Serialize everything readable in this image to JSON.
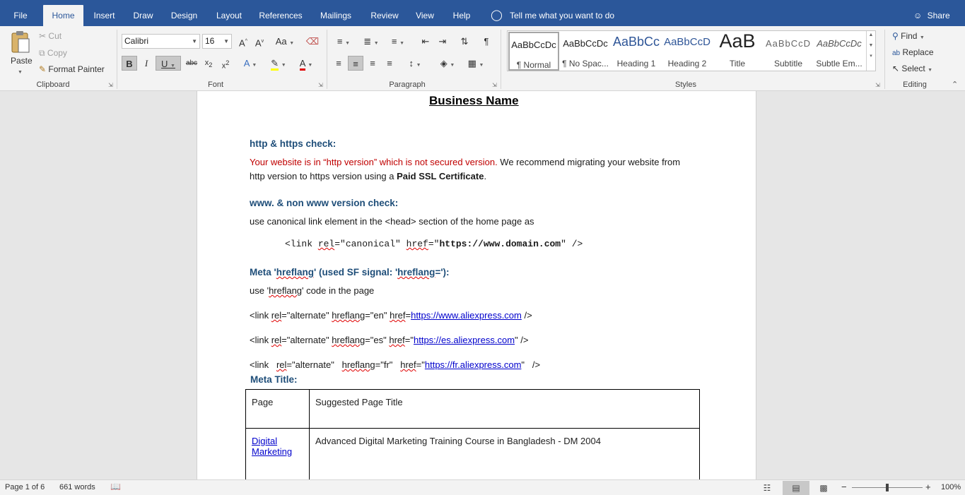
{
  "tabs": {
    "file": "File",
    "home": "Home",
    "insert": "Insert",
    "draw": "Draw",
    "design": "Design",
    "layout": "Layout",
    "references": "References",
    "mailings": "Mailings",
    "review": "Review",
    "view": "View",
    "help": "Help"
  },
  "tell_me": "Tell me what you want to do",
  "share": "Share",
  "clipboard": {
    "paste": "Paste",
    "cut": "Cut",
    "copy": "Copy",
    "format_painter": "Format Painter",
    "label": "Clipboard"
  },
  "font": {
    "name": "Calibri",
    "size": "16",
    "label": "Font"
  },
  "paragraph": {
    "label": "Paragraph"
  },
  "styles": {
    "label": "Styles",
    "items": [
      {
        "sample": "AaBbCcDc",
        "name": "¶ Normal"
      },
      {
        "sample": "AaBbCcDc",
        "name": "¶ No Spac..."
      },
      {
        "sample": "AaBbCc",
        "name": "Heading 1"
      },
      {
        "sample": "AaBbCcD",
        "name": "Heading 2"
      },
      {
        "sample": "AaB",
        "name": "Title"
      },
      {
        "sample": "AaBbCcD",
        "name": "Subtitle"
      },
      {
        "sample": "AaBbCcDc",
        "name": "Subtle Em..."
      }
    ]
  },
  "editing": {
    "find": "Find",
    "replace": "Replace",
    "select": "Select",
    "label": "Editing"
  },
  "document": {
    "title": "Business Name",
    "h_http": "http & https check:",
    "http_red": "Your website is in “http version” which is not secured version.",
    "http_rest": " We recommend migrating your website from",
    "http_line2_a": "http version to https version using a ",
    "http_line2_b": "Paid SSL Certificate",
    "http_line2_c": ".",
    "h_www": "www. & non www version check:",
    "www_text": "use canonical link element in the <head> section of the home page as",
    "code_a": "<link ",
    "code_rel": "rel",
    "code_b": "=\"canonical\" ",
    "code_href": "href",
    "code_c": "=\"",
    "code_url": "https://www.domain.com",
    "code_d": "\" />",
    "h_hreflang_a": "Meta '",
    "h_hreflang_b": "hreflang",
    "h_hreflang_c": "' (used SF signal: '",
    "h_hreflang_d": "hreflang",
    "h_hreflang_e": "='):",
    "hreflang_text_a": "use '",
    "hreflang_text_b": "hreflang",
    "hreflang_text_c": "' code in the page",
    "link_lines": [
      {
        "pre": "<link ",
        "rel": "rel",
        "mid1": "=\"alternate\" ",
        "hl": "hreflang",
        "mid2": "=\"en\" ",
        "href": "href",
        "mid3": "=",
        "url": "https://www.aliexpress.com",
        "post": " />"
      },
      {
        "pre": "<link ",
        "rel": "rel",
        "mid1": "=\"alternate\" ",
        "hl": "hreflang",
        "mid2": "=\"es\" ",
        "href": "href",
        "mid3": "=\"",
        "url": "https://es.aliexpress.com",
        "post": "\" />"
      },
      {
        "pre": "<link   ",
        "rel": "rel",
        "mid1": "=\"alternate\"   ",
        "hl": "hreflang",
        "mid2": "=\"fr\"   ",
        "href": "href",
        "mid3": "=\"",
        "url": "https://fr.aliexpress.com",
        "post": "\"   />"
      }
    ],
    "h_meta_title": "Meta Title:",
    "table": {
      "header": [
        "Page",
        "Suggested Page Title"
      ],
      "rows": [
        {
          "page": "Digital Marketing",
          "title": "Advanced Digital Marketing Training Course in Bangladesh - DM 2004"
        }
      ]
    }
  },
  "status": {
    "page": "Page 1 of 6",
    "words": "661 words",
    "zoom": "100%"
  }
}
